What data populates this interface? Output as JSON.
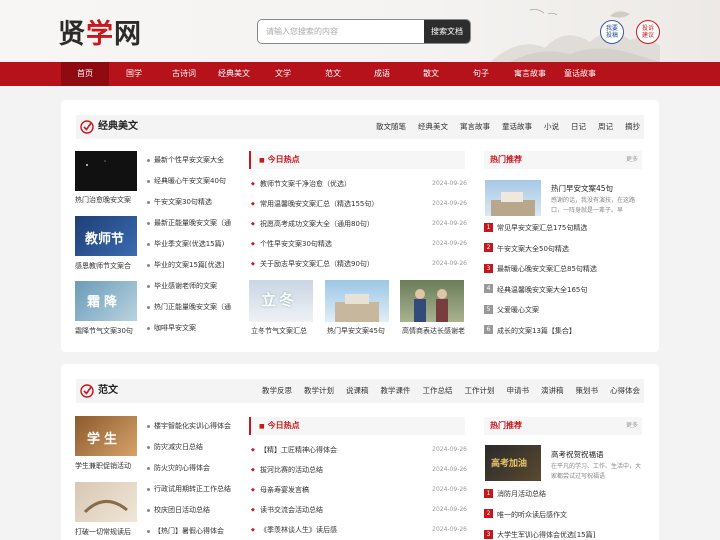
{
  "header": {
    "logo": [
      "贤",
      "学",
      "网"
    ],
    "search_placeholder": "请输入您搜索的内容",
    "search_button": "搜索文档",
    "contribute": [
      "我要",
      "投稿"
    ],
    "suggest": [
      "投诉",
      "建议"
    ]
  },
  "nav": [
    "首页",
    "国学",
    "古诗词",
    "经典美文",
    "文学",
    "范文",
    "成语",
    "散文",
    "句子",
    "寓言故事",
    "童话故事"
  ],
  "section1": {
    "title": "经典美文",
    "subnav": [
      "散文随笔",
      "经典美文",
      "寓言故事",
      "童话故事",
      "小说",
      "日记",
      "周记",
      "摘抄"
    ],
    "thumbs": [
      {
        "caption": "热门治愈晚安文案",
        "overlay": ""
      },
      {
        "caption": "感恩教师节文案合",
        "overlay": "教师节"
      },
      {
        "caption": "霜降节气文案30句",
        "overlay": "霜降"
      }
    ],
    "mid_list": [
      "最新个性早安文案大全",
      "经典暖心午安文案40句",
      "午安文案30句精选",
      "最新正能量晚安文案（通",
      "毕业季文案(优选15篇)",
      "毕业的文案15篇[优选]",
      "毕业感谢老师的文案",
      "热门正能量晚安文案（通",
      "咖啡早安文案"
    ],
    "hot_title": "今日热点",
    "hot": [
      {
        "t": "教师节文案千净治愈（优选）",
        "d": "2024-09-26"
      },
      {
        "t": "常用温馨晚安文案汇总（精选155句）",
        "d": "2024-09-26"
      },
      {
        "t": "祝愿高考成功文案大全（通用80句）",
        "d": "2024-09-26"
      },
      {
        "t": "个性早安文案30句精选",
        "d": "2024-09-26"
      },
      {
        "t": "关于励志早安文案汇总（精选90句）",
        "d": "2024-09-26"
      }
    ],
    "pics": [
      {
        "caption": "立冬节气文案汇总",
        "overlay": "立冬"
      },
      {
        "caption": "热门早安文案45句",
        "overlay": ""
      },
      {
        "caption": "高情商表达长感谢老",
        "overlay": ""
      }
    ],
    "rec_title": "热门推荐",
    "more": "更多",
    "rec_top": {
      "title": "热门早安文案45句",
      "desc": "感谢的话，我没有演技，在这路口，一阵身就是一辈子。早"
    },
    "rec_list": [
      "常见早安文案汇总175句精选",
      "午安文案大全50句精选",
      "最新暖心晚安文案汇总85句精选",
      "经典温馨晚安文案大全165句",
      "父爱暖心文案",
      "成长的文案13篇【集合】"
    ]
  },
  "section2": {
    "title": "范文",
    "subnav": [
      "教学反思",
      "教学计划",
      "说课稿",
      "教学课件",
      "工作总结",
      "工作计划",
      "申请书",
      "演讲稿",
      "策划书",
      "心得体会"
    ],
    "thumbs": [
      {
        "caption": "学生兼职促销活动",
        "overlay": "学生"
      },
      {
        "caption": "打破一切常规读后",
        "overlay": ""
      }
    ],
    "mid_list": [
      "楼宇智能化实训心得体会",
      "防灾减灾日总结",
      "防火灾的心得体会",
      "行政试用期转正工作总结",
      "校庆团日活动总结",
      "【热门】暑假心得体会"
    ],
    "hot_title": "今日热点",
    "hot": [
      {
        "t": "【精】工匠精神心得体会",
        "d": "2024-09-26"
      },
      {
        "t": "拔河比赛的活动总结",
        "d": "2024-09-26"
      },
      {
        "t": "母亲寿宴发言稿",
        "d": "2024-09-26"
      },
      {
        "t": "读书交流会活动总结",
        "d": "2024-09-26"
      },
      {
        "t": "《季羡林谈人生》读后感",
        "d": "2024-09-26"
      }
    ],
    "rec_title": "热门推荐",
    "more": "更多",
    "rec_top": {
      "title": "高考祝贺祝福语",
      "desc": "在平凡的学习、工作、生活中，大家都尝试过写祝福语",
      "overlay": "高考加油"
    },
    "rec_list": [
      "消防月活动总结",
      "唯一的听众读后感作文",
      "大学生军训心得体会优选[15篇]"
    ]
  },
  "colors": {
    "brand": "#b5121b",
    "nav_active": "#8e0b12",
    "accent": "#c8161d"
  }
}
